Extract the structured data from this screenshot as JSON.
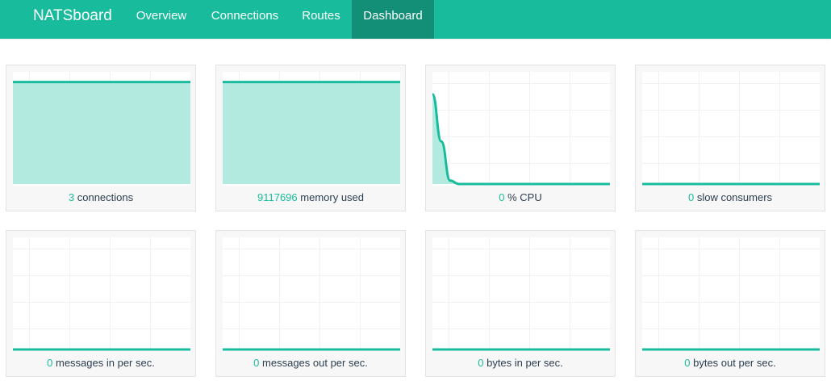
{
  "navbar": {
    "brand": "NATSboard",
    "items": [
      {
        "id": "overview",
        "label": "Overview",
        "active": false
      },
      {
        "id": "connections",
        "label": "Connections",
        "active": false
      },
      {
        "id": "routes",
        "label": "Routes",
        "active": false
      },
      {
        "id": "dashboard",
        "label": "Dashboard",
        "active": true
      }
    ]
  },
  "colors": {
    "primary": "#18bc9c",
    "primary_dark": "#128f76",
    "area_fill": "#b3eae0",
    "text": "#2c3e50"
  },
  "panels": [
    {
      "id": "connections",
      "value": "3",
      "label": "connections",
      "chart_data": {
        "type": "area",
        "values": [
          1,
          1
        ],
        "ylim": [
          0,
          1.1
        ]
      }
    },
    {
      "id": "memory",
      "value": "9117696",
      "label": "memory used",
      "chart_data": {
        "type": "area",
        "values": [
          1,
          1
        ],
        "ylim": [
          0,
          1.1
        ]
      }
    },
    {
      "id": "cpu",
      "value": "0",
      "label": "% CPU",
      "chart_data": {
        "type": "area",
        "values": [
          0.8,
          0.38,
          0.03,
          0,
          0,
          0,
          0,
          0,
          0,
          0,
          0,
          0,
          0,
          0,
          0,
          0,
          0,
          0,
          0,
          0,
          0
        ],
        "ylim": [
          0,
          1
        ]
      }
    },
    {
      "id": "slow-consumers",
      "value": "0",
      "label": "slow consumers",
      "chart_data": {
        "type": "area",
        "values": [
          0,
          0
        ],
        "ylim": [
          0,
          1
        ]
      }
    },
    {
      "id": "messages-in",
      "value": "0",
      "label": "messages in per sec.",
      "chart_data": {
        "type": "area",
        "values": [
          0,
          0
        ],
        "ylim": [
          0,
          1
        ]
      }
    },
    {
      "id": "messages-out",
      "value": "0",
      "label": "messages out per sec.",
      "chart_data": {
        "type": "area",
        "values": [
          0,
          0
        ],
        "ylim": [
          0,
          1
        ]
      }
    },
    {
      "id": "bytes-in",
      "value": "0",
      "label": "bytes in per sec.",
      "chart_data": {
        "type": "area",
        "values": [
          0,
          0
        ],
        "ylim": [
          0,
          1
        ]
      }
    },
    {
      "id": "bytes-out",
      "value": "0",
      "label": "bytes out per sec.",
      "chart_data": {
        "type": "area",
        "values": [
          0,
          0
        ],
        "ylim": [
          0,
          1
        ]
      }
    }
  ]
}
